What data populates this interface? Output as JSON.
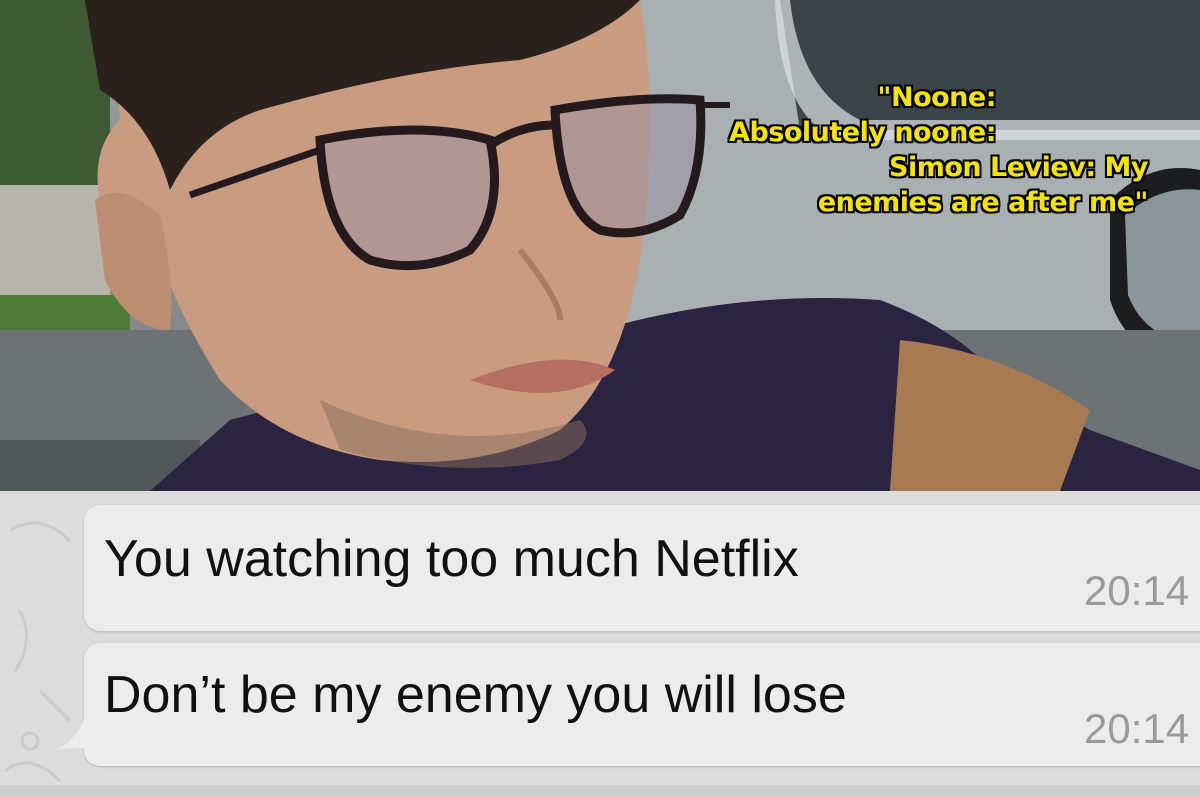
{
  "meme": {
    "caption_lines": [
      "\"Noone:",
      "Absolutely noone:",
      "Simon Leviev: My",
      "enemies are after me\""
    ],
    "caption_color": "#f5e400"
  },
  "chat": {
    "messages": [
      {
        "text": "You watching too much Netflix",
        "time": "20:14"
      },
      {
        "text": "Don’t be my enemy you will lose",
        "time": "20:14"
      }
    ],
    "bubble_color": "#ececec"
  }
}
